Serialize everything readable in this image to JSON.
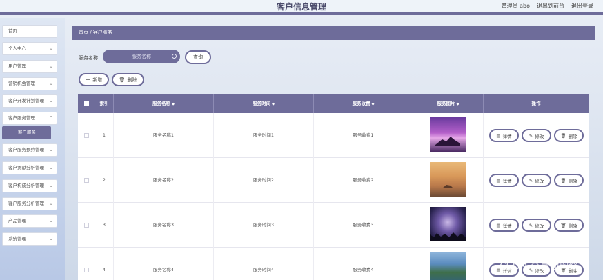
{
  "header": {
    "title": "客户信息管理",
    "admin": "管理员 abo",
    "front": "退出到前台",
    "logout": "退出登录"
  },
  "sidebar": {
    "items": [
      {
        "label": "首页"
      },
      {
        "label": "个人中心"
      },
      {
        "label": "用户管理"
      },
      {
        "label": "营销机会管理"
      },
      {
        "label": "客户开发计划管理"
      },
      {
        "label": "客户服务管理"
      },
      {
        "label": "客户服务"
      },
      {
        "label": "客户服务预约管理"
      },
      {
        "label": "客户贡献分析管理"
      },
      {
        "label": "客户构成分析管理"
      },
      {
        "label": "客户服务分析管理"
      },
      {
        "label": "产品管理"
      },
      {
        "label": "系统管理"
      }
    ]
  },
  "breadcrumb": "首页 / 客户服务",
  "search": {
    "label": "服务名称",
    "placeholder": "服务名称",
    "query_button": "查询"
  },
  "toolbar": {
    "add_label": "新增",
    "delete_label": "删除"
  },
  "table": {
    "headers": [
      "索引",
      "服务名称",
      "服务时间",
      "服务收费",
      "服务图片",
      "操作"
    ],
    "rows": [
      {
        "index": "1",
        "name": "服务名称1",
        "time": "服务时间1",
        "fee": "服务收费1"
      },
      {
        "index": "2",
        "name": "服务名称2",
        "time": "服务时间2",
        "fee": "服务收费2"
      },
      {
        "index": "3",
        "name": "服务名称3",
        "time": "服务时间3",
        "fee": "服务收费3"
      },
      {
        "index": "4",
        "name": "服务名称4",
        "time": "服务时间4",
        "fee": "服务收费4"
      }
    ],
    "actions": {
      "detail": "详情",
      "edit": "修改",
      "delete": "删除"
    }
  },
  "colors": {
    "accent": "#6e6c9a"
  },
  "watermark": "CSDN @真仙网络"
}
